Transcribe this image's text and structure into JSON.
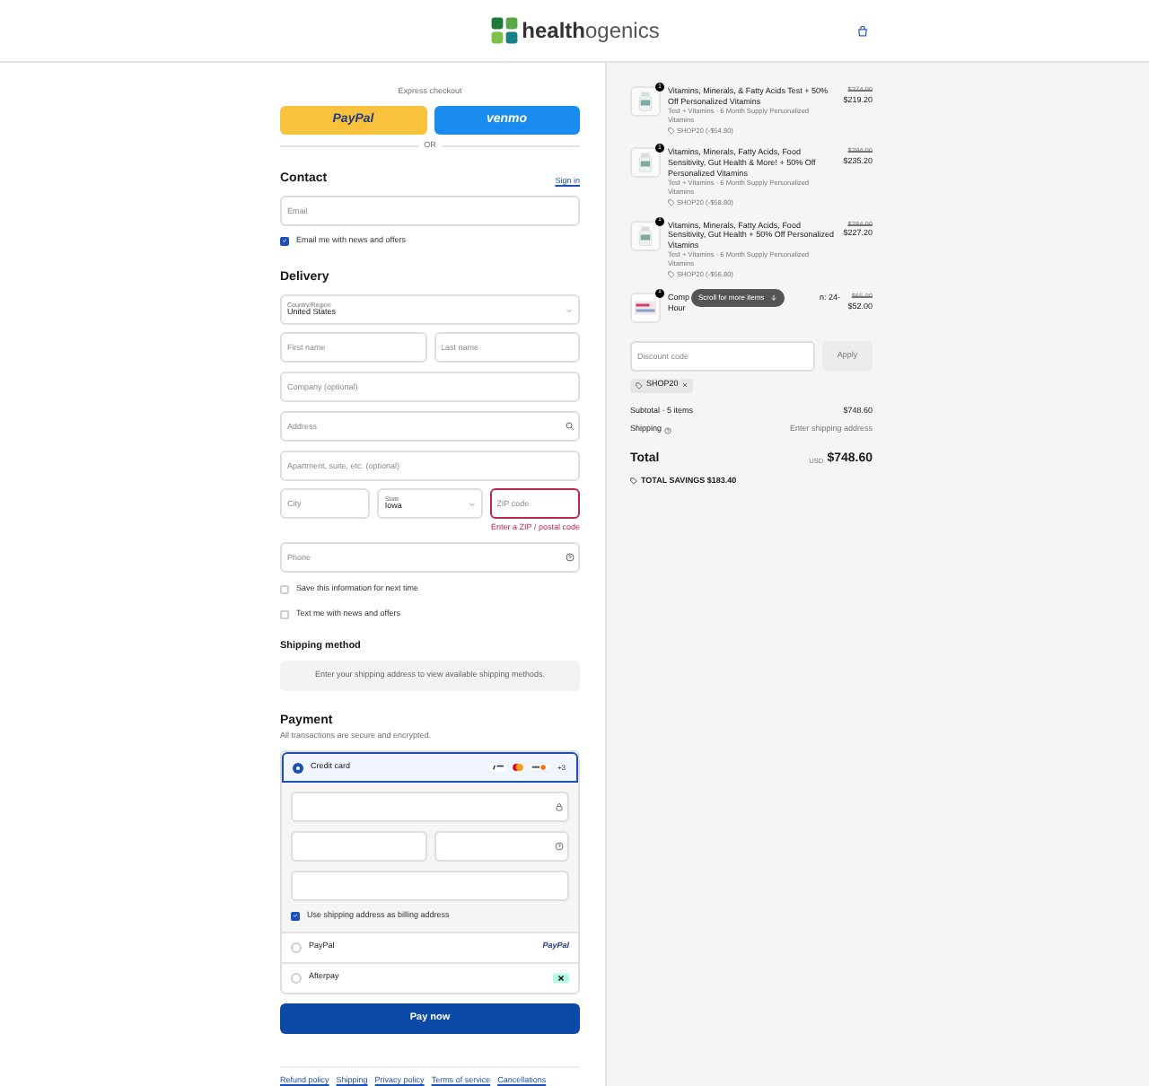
{
  "header": {
    "logo_bold": "health",
    "logo_rest": "ogenics"
  },
  "express": {
    "label": "Express checkout",
    "paypal": "PayPal",
    "venmo": "venmo",
    "or": "OR"
  },
  "contact": {
    "title": "Contact",
    "sign_in": "Sign in",
    "email": {
      "placeholder": "Email"
    },
    "news": {
      "label": "Email me with news and offers",
      "checked": true
    }
  },
  "delivery": {
    "title": "Delivery",
    "country_label": "Country/Region",
    "country": "United States",
    "first": {
      "placeholder": "First name"
    },
    "last": {
      "placeholder": "Last name"
    },
    "company": {
      "placeholder": "Company (optional)"
    },
    "address": {
      "placeholder": "Address"
    },
    "apartment": {
      "placeholder": "Apartment, suite, etc. (optional)"
    },
    "city": {
      "placeholder": "City"
    },
    "state_label": "State",
    "state": "Iowa",
    "zip": {
      "placeholder": "ZIP code"
    },
    "zip_error": "Enter a ZIP / postal code",
    "phone": {
      "placeholder": "Phone"
    },
    "options": [
      {
        "label": "Save this information for next time",
        "checked": false
      },
      {
        "label": "Text me with news and offers",
        "checked": false
      }
    ]
  },
  "shipping": {
    "title": "Shipping method",
    "notice": "Enter your shipping address to view available shipping methods."
  },
  "payment": {
    "title": "Payment",
    "subtitle": "All transactions are secure and encrypted.",
    "methods": [
      {
        "kind": "card",
        "label": "Credit card",
        "selected": true,
        "more": "+3"
      },
      {
        "kind": "paypal",
        "label": "PayPal",
        "selected": false,
        "brand": "PayPal"
      },
      {
        "kind": "afterpay",
        "label": "Afterpay",
        "selected": false
      }
    ],
    "billing": {
      "label": "Use shipping address as billing address",
      "checked": true
    },
    "pay": "Pay now"
  },
  "footer": [
    "Refund policy",
    "Shipping",
    "Privacy policy",
    "Terms of service",
    "Cancellations"
  ],
  "items": [
    {
      "kind": "full",
      "qty": "1",
      "title": "Vitamins, Minerals, & Fatty Acids Test + 50% Off Personalized Vitamins",
      "sub": "Test + Vitamins · 6 Month Supply Personalized Vitamins",
      "discount": "SHOP20 (-$54.80)",
      "was": "$274.00",
      "price": "$219.20"
    },
    {
      "kind": "full",
      "qty": "1",
      "title": "Vitamins, Minerals, Fatty Acids, Food Sensitivity, Gut Health & More! + 50% Off Personalized Vitamins",
      "sub": "Test + Vitamins · 6 Month Supply Personalized Vitamins",
      "discount": "SHOP20 (-$58.80)",
      "was": "$294.00",
      "price": "$235.20"
    },
    {
      "kind": "full",
      "qty": "1",
      "title": "Vitamins, Minerals, Fatty Acids, Food Sensitivity, Gut Health + 50% Off Personalized Vitamins",
      "sub": "Test + Vitamins · 6 Month Supply Personalized Vitamins",
      "discount": "SHOP20 (-$56.80)",
      "was": "$284.00",
      "price": "$227.20"
    },
    {
      "kind": "partial",
      "qty": "1",
      "start": "Comp",
      "end": "n: 24-",
      "line2": "Hour",
      "was": "$65.00",
      "price": "$52.00"
    }
  ],
  "scroll_hint": "Scroll for more items",
  "discount": {
    "placeholder": "Discount code",
    "apply": "Apply",
    "code": "SHOP20"
  },
  "summary": {
    "subtotal_label": "Subtotal · 5 items",
    "subtotal": "$748.60",
    "shipping_label": "Shipping",
    "shipping": "Enter shipping address",
    "total_label": "Total",
    "currency": "USD",
    "total": "$748.60",
    "savings": "TOTAL SAVINGS $183.40"
  }
}
